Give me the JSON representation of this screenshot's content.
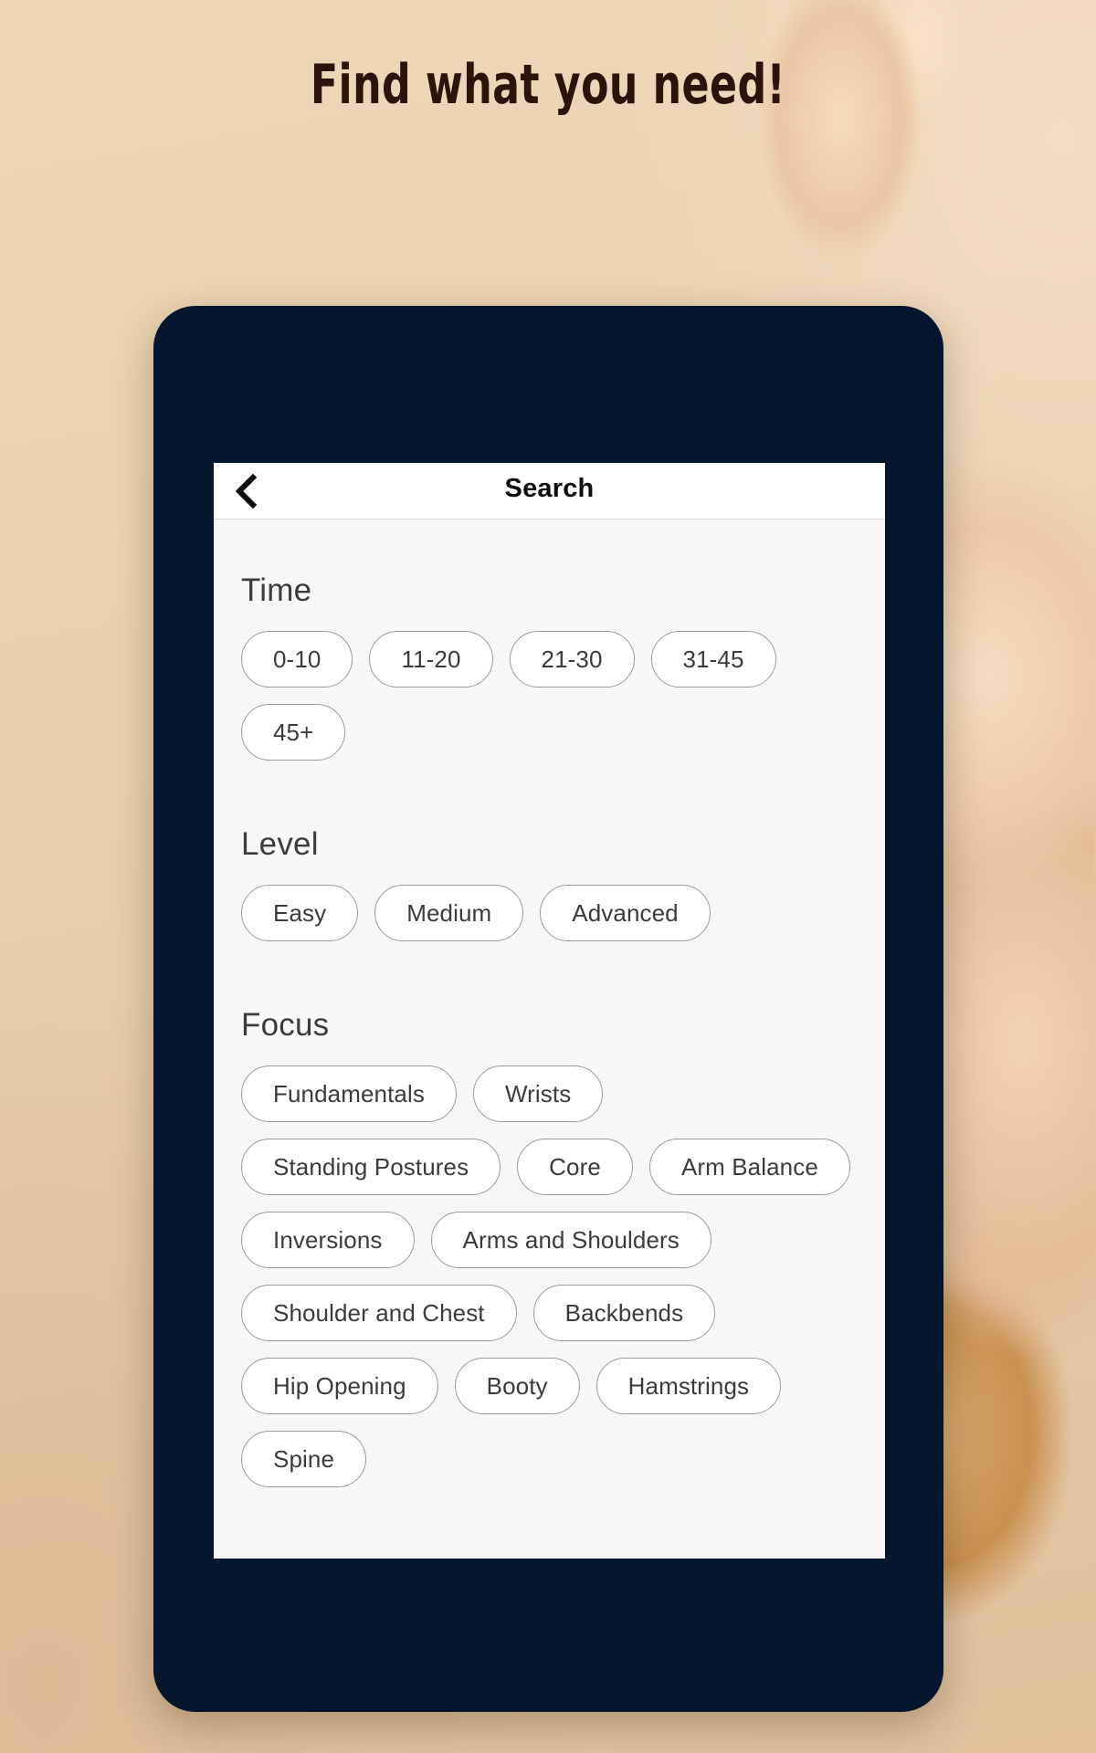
{
  "headline": "Find what you need!",
  "colors": {
    "page_background": "#e9cfae",
    "device_frame": "#04172e",
    "screen_background": "#f6f7f7",
    "appbar_background": "#ffffff",
    "chip_border": "#9a9a9a",
    "chip_background": "#ffffff",
    "headline_text": "#2a140c"
  },
  "appbar": {
    "back_icon": "chevron-left-icon",
    "title": "Search"
  },
  "sections": [
    {
      "id": "time",
      "title": "Time",
      "chips": [
        "0-10",
        "11-20",
        "21-30",
        "31-45",
        "45+"
      ]
    },
    {
      "id": "level",
      "title": "Level",
      "chips": [
        "Easy",
        "Medium",
        "Advanced"
      ]
    },
    {
      "id": "focus",
      "title": "Focus",
      "chips": [
        "Fundamentals",
        "Wrists",
        "Standing Postures",
        "Core",
        "Arm Balance",
        "Inversions",
        "Arms and Shoulders",
        "Shoulder and Chest",
        "Backbends",
        "Hip Opening",
        "Booty",
        "Hamstrings",
        "Spine"
      ]
    }
  ]
}
